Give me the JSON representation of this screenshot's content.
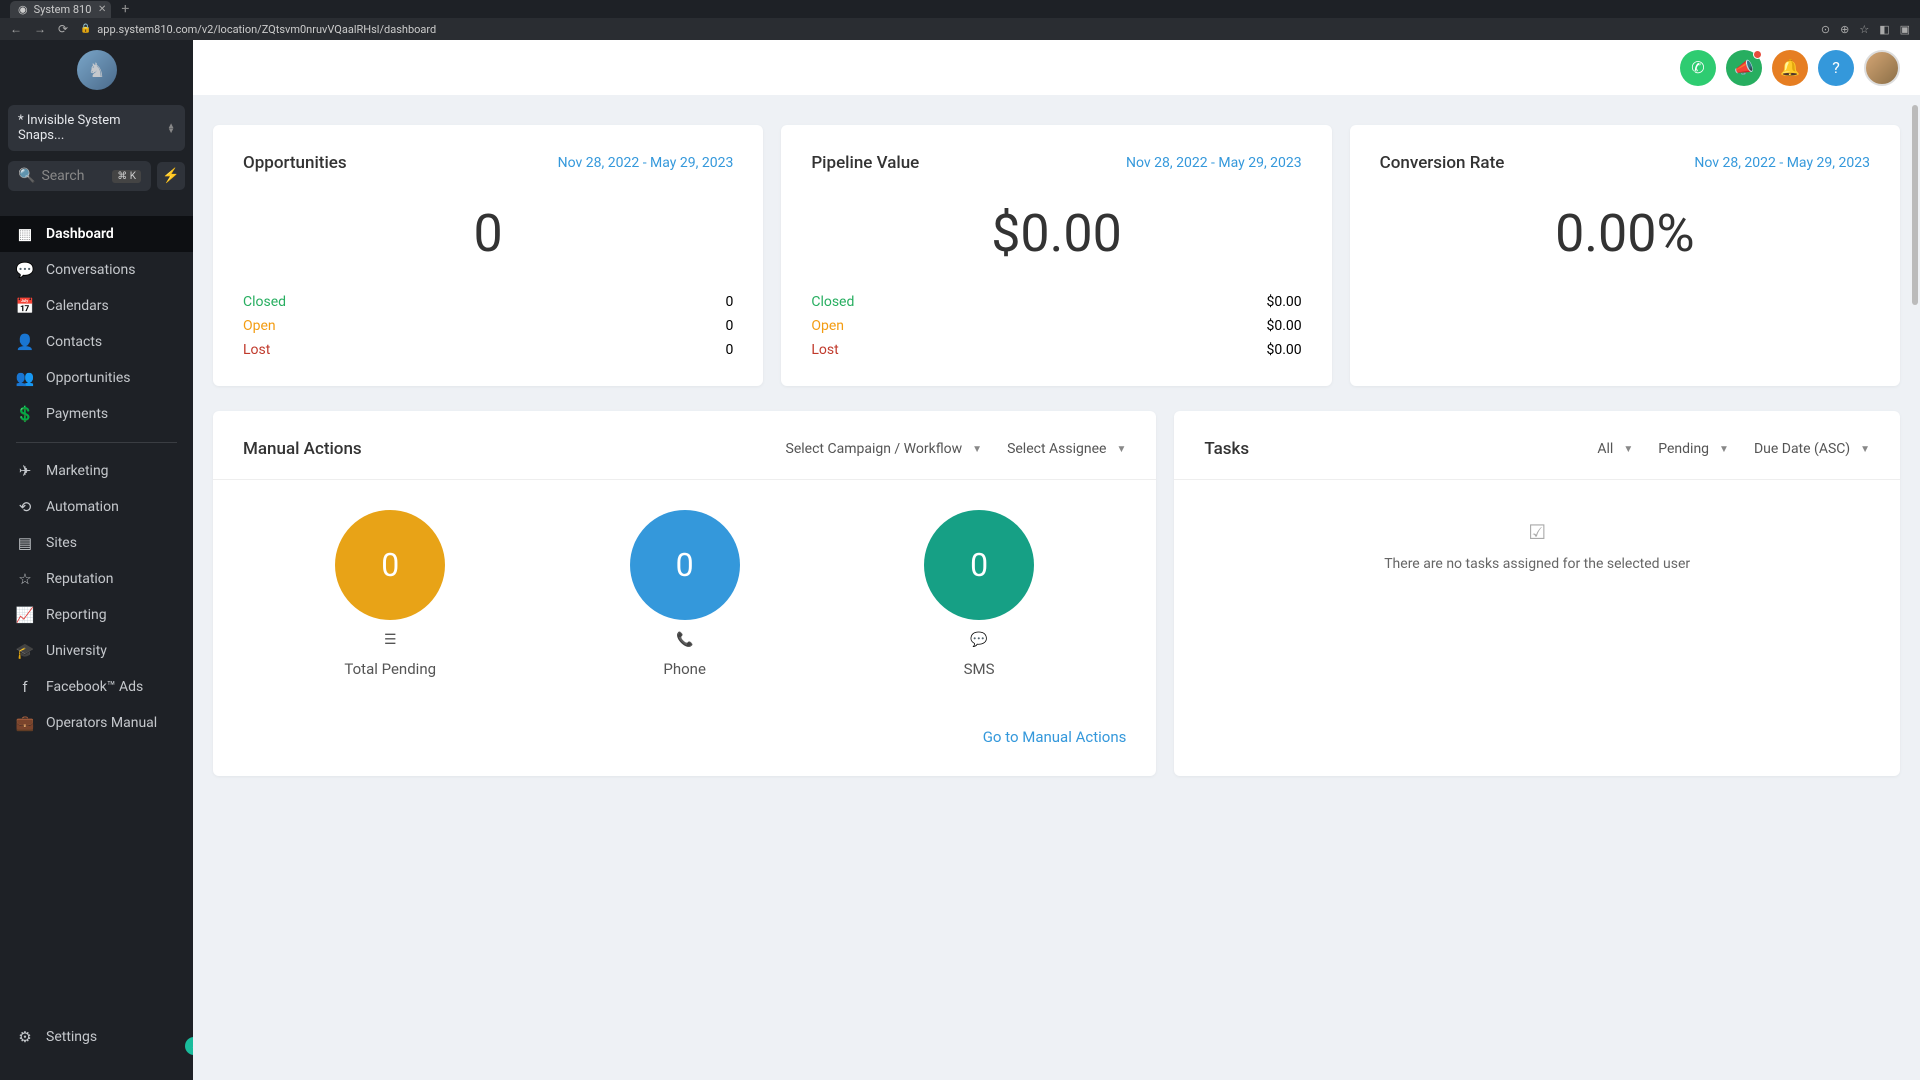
{
  "browser": {
    "tab_title": "System 810",
    "url": "app.system810.com/v2/location/ZQtsvm0nruvVQaalRHsl/dashboard"
  },
  "sidebar": {
    "account": "* Invisible System Snaps...",
    "search_placeholder": "Search",
    "search_kbd": "⌘ K",
    "items": [
      {
        "label": "Dashboard",
        "icon": "grid"
      },
      {
        "label": "Conversations",
        "icon": "chat"
      },
      {
        "label": "Calendars",
        "icon": "calendar"
      },
      {
        "label": "Contacts",
        "icon": "user"
      },
      {
        "label": "Opportunities",
        "icon": "people"
      },
      {
        "label": "Payments",
        "icon": "dollar"
      }
    ],
    "items2": [
      {
        "label": "Marketing",
        "icon": "send"
      },
      {
        "label": "Automation",
        "icon": "refresh"
      },
      {
        "label": "Sites",
        "icon": "layout"
      },
      {
        "label": "Reputation",
        "icon": "star"
      },
      {
        "label": "Reporting",
        "icon": "trend"
      },
      {
        "label": "University",
        "icon": "grad"
      },
      {
        "label": "Facebook™ Ads",
        "icon": "fb"
      },
      {
        "label": "Operators Manual",
        "icon": "briefcase"
      }
    ],
    "settings_label": "Settings"
  },
  "stats": {
    "date_range": "Nov 28, 2022 - May 29, 2023",
    "opportunities": {
      "title": "Opportunities",
      "value": "0",
      "closed": "0",
      "open": "0",
      "lost": "0"
    },
    "pipeline": {
      "title": "Pipeline Value",
      "value": "$0.00",
      "closed": "$0.00",
      "open": "$0.00",
      "lost": "$0.00"
    },
    "conversion": {
      "title": "Conversion Rate",
      "value": "0.00%"
    },
    "labels": {
      "closed": "Closed",
      "open": "Open",
      "lost": "Lost"
    }
  },
  "manual_actions": {
    "title": "Manual Actions",
    "campaign_dd": "Select Campaign / Workflow",
    "assignee_dd": "Select Assignee",
    "pending": {
      "label": "Total Pending",
      "value": "0"
    },
    "phone": {
      "label": "Phone",
      "value": "0"
    },
    "sms": {
      "label": "SMS",
      "value": "0"
    },
    "goto": "Go to Manual Actions"
  },
  "tasks": {
    "title": "Tasks",
    "filter_all": "All",
    "filter_status": "Pending",
    "filter_sort": "Due Date (ASC)",
    "empty": "There are no tasks assigned for the selected user"
  }
}
